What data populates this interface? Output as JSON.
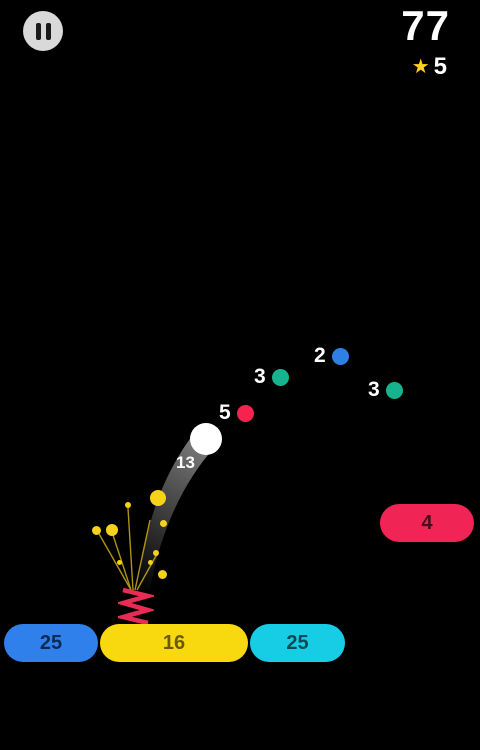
{
  "hud": {
    "score": "77",
    "stars": "5",
    "star_color": "#ffd21f"
  },
  "bubbles": [
    {
      "value": "2",
      "color": "#2e7fe6"
    },
    {
      "value": "3",
      "color": "#17b38f"
    },
    {
      "value": "3",
      "color": "#17b38f"
    },
    {
      "value": "5",
      "color": "#f4244f"
    }
  ],
  "player": {
    "ball_count": "13",
    "ball_color": "#ffffff",
    "spring_color": "#ea2b55"
  },
  "blocks": {
    "right_block": {
      "value": "4",
      "color": "#f02455"
    }
  },
  "platforms": [
    {
      "value": "25",
      "color": "#2f80ea"
    },
    {
      "value": "16",
      "color": "#f8d80f"
    },
    {
      "value": "25",
      "color": "#17cde6"
    }
  ]
}
